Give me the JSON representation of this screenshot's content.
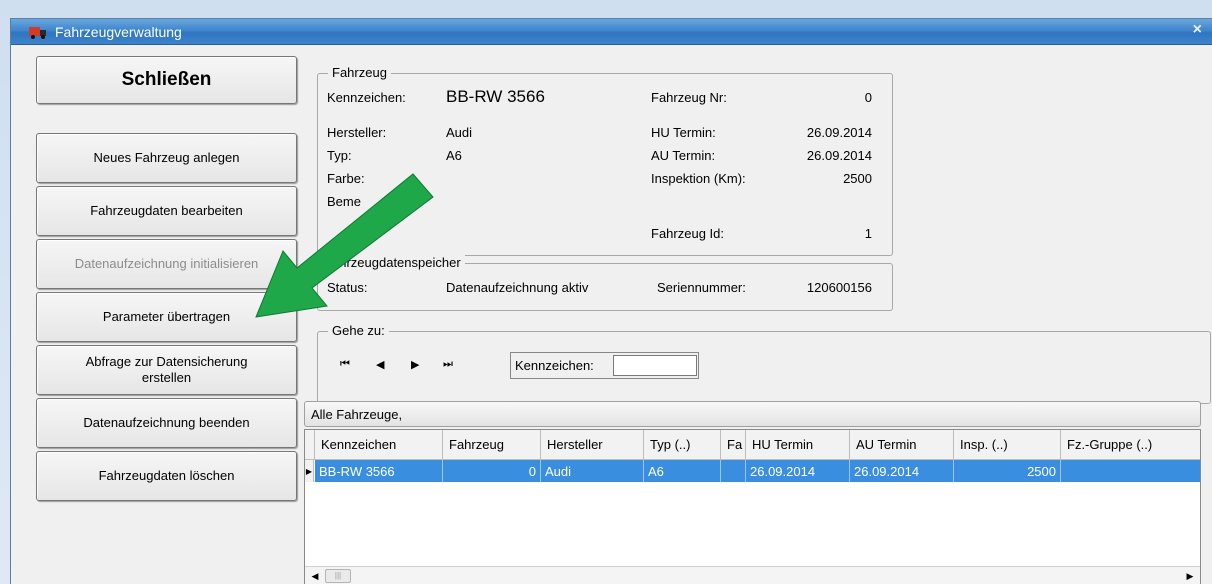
{
  "window": {
    "title": "Fahrzeugverwaltung",
    "close": "×"
  },
  "buttons": {
    "close": "Schließen",
    "new_vehicle": "Neues Fahrzeug anlegen",
    "edit_vehicle": "Fahrzeugdaten bearbeiten",
    "init_recording": "Datenaufzeichnung initialisieren",
    "transfer_params": "Parameter übertragen",
    "backup_query_1": "Abfrage zur Datensicherung",
    "backup_query_2": "erstellen",
    "end_recording": "Datenaufzeichnung beenden",
    "delete_vehicle": "Fahrzeugdaten löschen"
  },
  "vehicle": {
    "legend": "Fahrzeug",
    "plate_label": "Kennzeichen:",
    "plate": "BB-RW 3566",
    "number_label": "Fahrzeug Nr:",
    "number": "0",
    "maker_label": "Hersteller:",
    "maker": "Audi",
    "hu_label": "HU Termin:",
    "hu": "26.09.2014",
    "type_label": "Typ:",
    "type": "A6",
    "au_label": "AU Termin:",
    "au": "26.09.2014",
    "color_label": "Farbe:",
    "insp_label": "Inspektion (Km):",
    "insp": "2500",
    "remark_label": "Beme",
    "id_label": "Fahrzeug Id:",
    "id": "1"
  },
  "storage": {
    "legend": "ahrzeugdatenspeicher",
    "status_label": "Status:",
    "status": "Datenaufzeichnung aktiv",
    "serial_label": "Seriennummer:",
    "serial": "120600156"
  },
  "goto": {
    "legend": "Gehe zu:",
    "first": "⏮",
    "prev": "◀",
    "next": "▶",
    "last": "⏭",
    "plate_label": "Kennzeichen:",
    "plate_value": ""
  },
  "grid": {
    "header": "Alle Fahrzeuge,",
    "columns": [
      "Kennzeichen",
      "Fahrzeug",
      "Hersteller",
      "Typ (..)",
      "Fa",
      "HU Termin",
      "AU Termin",
      "Insp. (..)",
      "Fz.-Gruppe (..)"
    ],
    "rows": [
      [
        "BB-RW 3566",
        "0",
        "Audi",
        "A6",
        "",
        "26.09.2014",
        "26.09.2014",
        "2500",
        ""
      ]
    ]
  },
  "colors": {
    "selection": "#3a8ee0",
    "arrow": "#1ea84a",
    "titlebar": "#3f86cf"
  }
}
